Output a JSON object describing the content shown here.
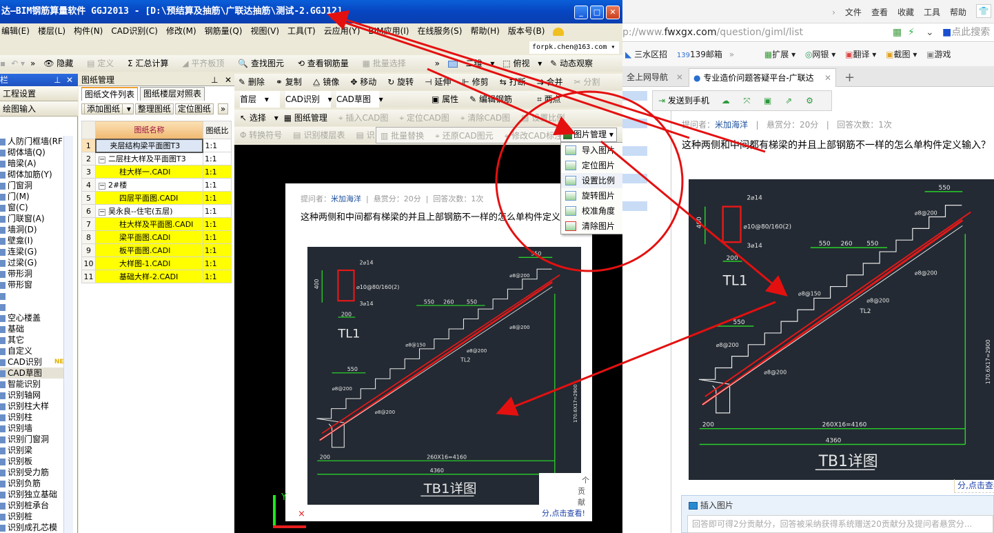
{
  "app": {
    "title": "达—BIM钢筋算量软件 GGJ2013 - [D:\\预结算及抽筋\\广联达抽筋\\测试-2.GGJ12]",
    "window_buttons": {
      "minimize": "_",
      "maximize": "□",
      "close": "✕"
    },
    "menu": [
      "编辑(E)",
      "楼层(L)",
      "构件(N)",
      "CAD识别(C)",
      "修改(M)",
      "钢筋量(Q)",
      "视图(V)",
      "工具(T)",
      "云应用(Y)",
      "BIM应用(I)",
      "在线服务(S)",
      "帮助(H)",
      "版本号(B)"
    ],
    "user_account": "forpk.chen@163.com",
    "toolbar1": {
      "items": [
        "隐藏",
        "定义",
        "汇总计算",
        "平齐板顶",
        "查找图元",
        "查看钢筋量",
        "批量选择"
      ],
      "disabled": [
        "定义",
        "平齐板顶",
        "批量选择"
      ],
      "view_mode": "二维",
      "view_angle": "俯视",
      "dynamic_view": "动态观察"
    },
    "toolbar2": [
      "删除",
      "复制",
      "镜像",
      "移动",
      "旋转",
      "延伸",
      "修剪",
      "打断",
      "合并",
      "分割"
    ],
    "toolbar3": {
      "floor": "首层",
      "category": "CAD识别",
      "sub_category": "CAD草图",
      "empty_select": "",
      "properties": "属性",
      "edit_rebar": "编辑钢筋",
      "two_points": "两点"
    },
    "toolbar4": {
      "select": "选择",
      "items": [
        "图纸管理",
        "插入CAD图",
        "定位CAD图",
        "清除CAD图",
        "设置比例"
      ]
    },
    "toolbar5": {
      "items": [
        "转换符号",
        "识别楼层表",
        "识",
        "批量替换",
        "还原CAD图元",
        "修改CAD标注"
      ],
      "pic_manage": "图片管理"
    },
    "picture_menu": [
      "导入图片",
      "定位图片",
      "设置比例",
      "旋转图片",
      "校准角度",
      "清除图片"
    ],
    "nav_panel": {
      "title": "栏",
      "sections": [
        "工程设置",
        "绘图输入"
      ],
      "items": [
        "人防门框墙(RF",
        "砌体墙(Q)",
        "暗梁(A)",
        "砌体加筋(Y)",
        "门窗洞",
        "门(M)",
        "窗(C)",
        "门联窗(A)",
        "墙洞(D)",
        "壁龛(I)",
        "连梁(G)",
        "过梁(G)",
        "带形洞",
        "带形窗",
        "",
        "",
        "空心楼盖",
        "基础",
        "其它",
        "自定义",
        "CAD识别",
        "CAD草图",
        "智能识别",
        "识别轴网",
        "识别柱大样",
        "识别柱",
        "识别墙",
        "识别门窗洞",
        "识别梁",
        "识别板",
        "识别受力筋",
        "识别负筋",
        "识别独立基础",
        "识别桩承台",
        "识别桩",
        "识别成孔芯模"
      ],
      "new_badge": "NEW",
      "selected": "CAD草图"
    },
    "drawing_panel": {
      "title": "图纸管理",
      "tabs": [
        "图纸文件列表",
        "图纸楼层对照表"
      ],
      "active_tab": "图纸文件列表",
      "buttons": [
        "添加图纸",
        "整理图纸",
        "定位图纸"
      ],
      "columns": [
        "",
        "图纸名称",
        "图纸比"
      ],
      "rows": [
        {
          "n": "1",
          "name": "夹层结构梁平面图T3",
          "scale": "1:1",
          "level": 0,
          "highlight": false,
          "selected": true
        },
        {
          "n": "2",
          "name": "二层柱大样及平面图T3",
          "scale": "1:1",
          "level": 0,
          "highlight": false,
          "group": true
        },
        {
          "n": "3",
          "name": "柱大样一.CADI",
          "scale": "1:1",
          "level": 1,
          "highlight": true
        },
        {
          "n": "4",
          "name": "2#楼",
          "scale": "1:1",
          "level": 0,
          "highlight": false,
          "group": true
        },
        {
          "n": "5",
          "name": "四层平面图.CADI",
          "scale": "1:1",
          "level": 1,
          "highlight": true
        },
        {
          "n": "6",
          "name": "吴永良--住宅(五层)",
          "scale": "1:1",
          "level": 0,
          "highlight": false,
          "group": true
        },
        {
          "n": "7",
          "name": "柱大样及平面图.CADI",
          "scale": "1:1",
          "level": 1,
          "highlight": true
        },
        {
          "n": "8",
          "name": "梁平面图.CADI",
          "scale": "1:1",
          "level": 1,
          "highlight": true
        },
        {
          "n": "9",
          "name": "板平面图.CADI",
          "scale": "1:1",
          "level": 1,
          "highlight": true
        },
        {
          "n": "10",
          "name": "大样图-1.CADI",
          "scale": "1:1",
          "level": 1,
          "highlight": true
        },
        {
          "n": "11",
          "name": "基础大样-2.CADI",
          "scale": "1:1",
          "level": 1,
          "highlight": true
        }
      ]
    },
    "canvas": {
      "axis_y": "Y",
      "embedded_card": {
        "asker_label": "提问者：",
        "asker": "米加海洋",
        "reward": "悬赏分：20分",
        "answers": "回答次数：1次",
        "question": "这种两侧和中间都有梯梁的并且上部钢筋不一样的怎么单构件定义输入？",
        "side_text": [
          "个",
          "贡献",
          "分,点击查看!"
        ]
      }
    }
  },
  "browser": {
    "menu": [
      "文件",
      "查看",
      "收藏",
      "工具",
      "帮助"
    ],
    "url_prefix": "p://www.",
    "url_domain": "fwxgx.com",
    "url_path": "/question/giml/list",
    "search_placeholder": "点此搜索",
    "favorites": [
      "三水区招",
      "139邮箱",
      "扩展",
      "网银",
      "翻译",
      "截图",
      "游戏"
    ],
    "tabs": [
      {
        "label": "全上网导航",
        "active": false
      },
      {
        "label": "专业造价问题答疑平台-广联达",
        "active": true
      }
    ],
    "new_tab": "+",
    "send_to_phone": "发送到手机",
    "question": {
      "asker_label": "提问者：",
      "asker": "米加海洋",
      "reward": "悬赏分：20分",
      "answers": "回答次数：1次",
      "text": "这种两侧和中间都有梯梁的并且上部钢筋不一样的怎么单构件定义输入？"
    },
    "insert_image": "插入图片",
    "answer_placeholder": "回答即可得2分贡献分，回答被采纳获得系统赠送20贡献分及提问者悬赏分...",
    "side_link": "分,点击查看"
  },
  "cad_drawing": {
    "title": "TB1详图",
    "beam_label": "TL1",
    "beam_label_2": "TL2",
    "dims": [
      "2⌀14",
      "⌀10@80/160(2)",
      "3⌀14",
      "400",
      "200",
      "550",
      "260",
      "550",
      "550",
      "550",
      "⌀8@200",
      "⌀8@150",
      "170.6X17=2900",
      "200",
      "260X16=4160",
      "4360"
    ]
  }
}
